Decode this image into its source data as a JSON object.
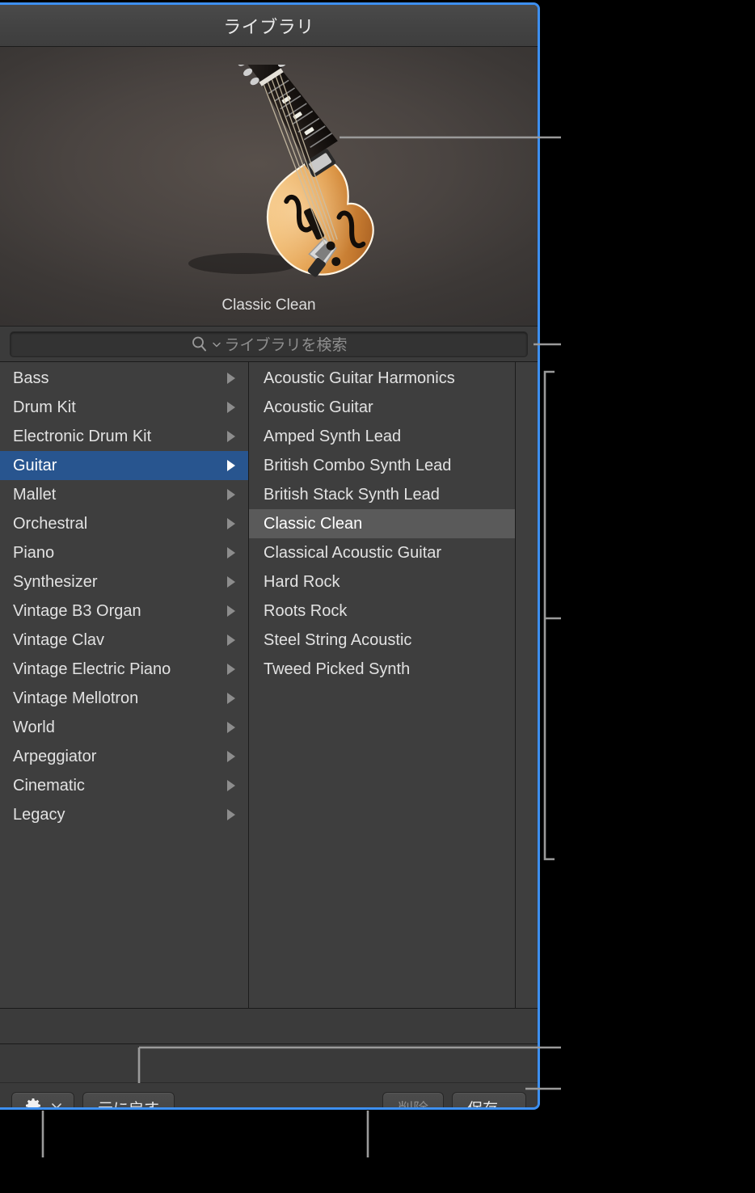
{
  "window": {
    "title": "ライブラリ",
    "accent_color": "#3d8ff0",
    "background_color": "#3a3a3a"
  },
  "preview": {
    "instrument_name": "Classic Clean",
    "artwork": "archtop-electric-guitar"
  },
  "search": {
    "placeholder": "ライブラリを検索",
    "value": "",
    "icon": "search-icon",
    "menu_icon": "chevron-down-icon"
  },
  "browser": {
    "categories": {
      "selected": "Guitar",
      "selection_color": "#28558f",
      "items": [
        {
          "label": "Bass",
          "has_submenu": true
        },
        {
          "label": "Drum Kit",
          "has_submenu": true
        },
        {
          "label": "Electronic Drum Kit",
          "has_submenu": true
        },
        {
          "label": "Guitar",
          "has_submenu": true
        },
        {
          "label": "Mallet",
          "has_submenu": true
        },
        {
          "label": "Orchestral",
          "has_submenu": true
        },
        {
          "label": "Piano",
          "has_submenu": true
        },
        {
          "label": "Synthesizer",
          "has_submenu": true
        },
        {
          "label": "Vintage B3 Organ",
          "has_submenu": true
        },
        {
          "label": "Vintage Clav",
          "has_submenu": true
        },
        {
          "label": "Vintage Electric Piano",
          "has_submenu": true
        },
        {
          "label": "Vintage Mellotron",
          "has_submenu": true
        },
        {
          "label": "World",
          "has_submenu": true
        },
        {
          "label": "Arpeggiator",
          "has_submenu": true
        },
        {
          "label": "Cinematic",
          "has_submenu": true
        },
        {
          "label": "Legacy",
          "has_submenu": true
        }
      ]
    },
    "patches": {
      "selected": "Classic Clean",
      "selection_color": "#5a5a5a",
      "items": [
        {
          "label": "Acoustic Guitar Harmonics"
        },
        {
          "label": "Acoustic Guitar"
        },
        {
          "label": "Amped Synth Lead"
        },
        {
          "label": "British Combo Synth Lead"
        },
        {
          "label": "British Stack Synth Lead"
        },
        {
          "label": "Classic Clean"
        },
        {
          "label": "Classical Acoustic Guitar"
        },
        {
          "label": "Hard Rock"
        },
        {
          "label": "Roots Rock"
        },
        {
          "label": "Steel String Acoustic"
        },
        {
          "label": "Tweed Picked Synth"
        }
      ]
    }
  },
  "toolbar": {
    "action_menu_icon": "gear-icon",
    "action_menu_chevron": "chevron-down-icon",
    "revert_label": "元に戻す",
    "delete_label": "削除",
    "delete_enabled": false,
    "save_label": "保存..."
  }
}
